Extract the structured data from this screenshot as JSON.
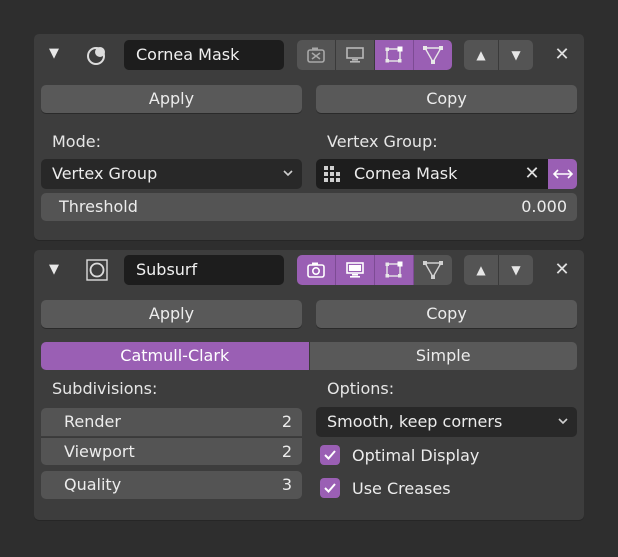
{
  "mask_modifier": {
    "name": "Cornea Mask",
    "apply_label": "Apply",
    "copy_label": "Copy",
    "mode_label": "Mode:",
    "mode_value": "Vertex Group",
    "vertex_group_label": "Vertex Group:",
    "vertex_group_value": "Cornea Mask",
    "threshold_label": "Threshold",
    "threshold_value": "0.000"
  },
  "subsurf_modifier": {
    "name": "Subsurf",
    "apply_label": "Apply",
    "copy_label": "Copy",
    "algorithms": [
      "Catmull-Clark",
      "Simple"
    ],
    "subdivisions_label": "Subdivisions:",
    "render_label": "Render",
    "render_value": "2",
    "viewport_label": "Viewport",
    "viewport_value": "2",
    "quality_label": "Quality",
    "quality_value": "3",
    "options_label": "Options:",
    "uv_smooth_value": "Smooth, keep corners",
    "optimal_display_label": "Optimal Display",
    "use_creases_label": "Use Creases"
  },
  "icons": {
    "collapse": "triangle-down-icon",
    "mask_type": "mask-modifier-icon",
    "subsurf_type": "subsurf-modifier-icon",
    "render": "camera-icon",
    "viewport": "monitor-icon",
    "editmode": "edit-mode-icon",
    "cage": "vertex-cage-icon",
    "move_up": "triangle-up-icon",
    "move_down": "triangle-down-icon",
    "remove": "close-icon",
    "group": "vertex-group-icon",
    "invert": "double-arrow-icon",
    "check": "checkmark-icon"
  },
  "colors": {
    "accent": "#9a5fb4",
    "panel": "#3d3d3d",
    "background": "#2e2e2e",
    "button": "#595959"
  }
}
